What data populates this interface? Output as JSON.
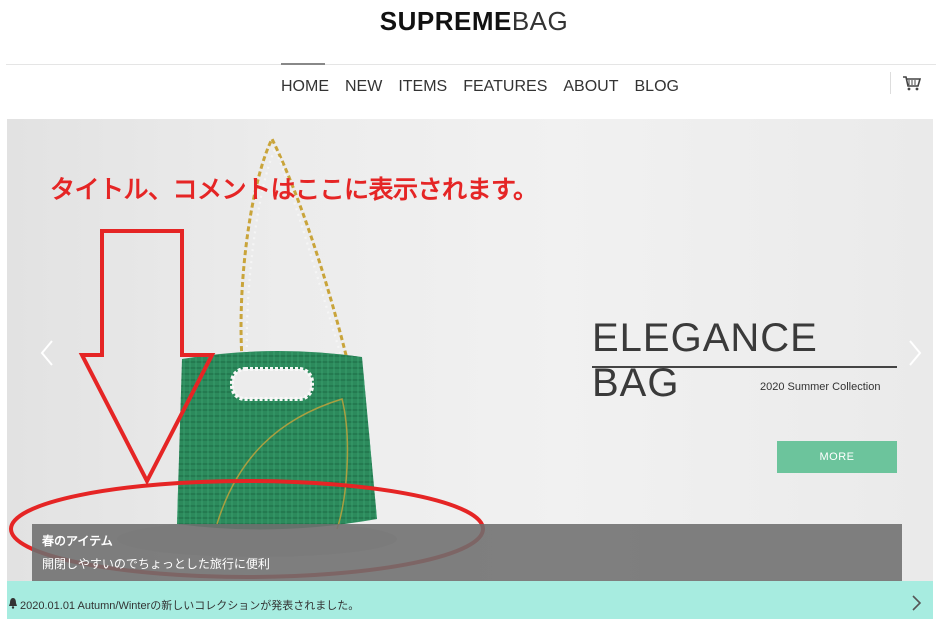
{
  "logo": {
    "bold": "SUPREME",
    "light": "BAG"
  },
  "nav": {
    "items": [
      "HOME",
      "NEW",
      "ITEMS",
      "FEATURES",
      "ABOUT",
      "BLOG"
    ],
    "active": "HOME"
  },
  "hero": {
    "headline": "ELEGANCE BAG",
    "subheadline": "2020 Summer Collection",
    "more_label": "MORE",
    "annotation": "タイトル、コメントはここに表示されます。",
    "caption_title": "春のアイテム",
    "caption_desc": "開閉しやすいのでちょっとした旅行に便利"
  },
  "news": {
    "text": "2020.01.01 Autumn/Winterの新しいコレクションが発表されました。"
  },
  "icons": {
    "cart": "cart-icon",
    "prev": "chevron-left-icon",
    "next": "chevron-right-icon",
    "bell": "bell-icon",
    "news_next": "chevron-right-icon"
  },
  "colors": {
    "accent": "#6cc49c",
    "news_bg": "#a7ece0",
    "annotation": "#e52525"
  }
}
